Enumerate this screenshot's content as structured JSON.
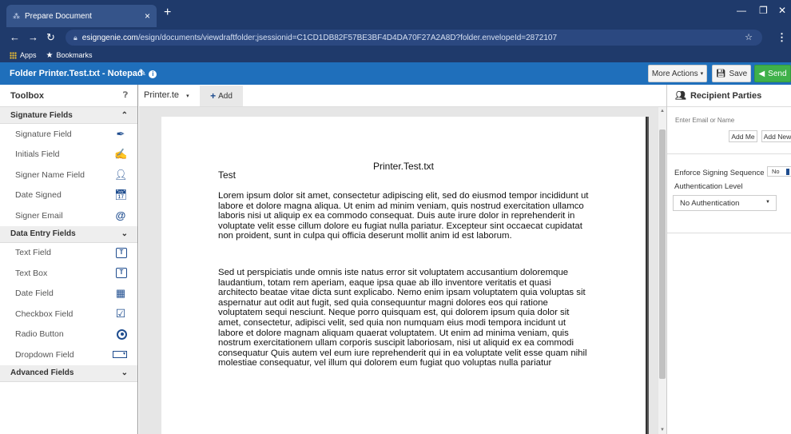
{
  "browser": {
    "tab_title": "Prepare Document",
    "tab_close": "×",
    "new_tab": "+",
    "url_host": "esigngenie.com",
    "url_path": "/esign/documents/viewdraftfolder;jsessionid=C1CD1DB82F57BE3BF4D4DA70F27A2A8D?folder.envelopeId=2872107",
    "bookmarks": [
      "Apps",
      "Bookmarks"
    ]
  },
  "header": {
    "folder_title": "Folder  Printer.Test.txt - Notepad",
    "more_actions_label": "More Actions",
    "save_label": "Save",
    "send_label": "Send"
  },
  "toolbox": {
    "title": "Toolbox",
    "sections": [
      {
        "label": "Signature Fields",
        "items": [
          "Signature Field",
          "Initials Field",
          "Signer Name Field",
          "Date Signed",
          "Signer Email"
        ]
      },
      {
        "label": "Data Entry Fields",
        "items": [
          "Text Field",
          "Text Box",
          "Date Field",
          "Checkbox Field",
          "Radio Button",
          "Dropdown Field"
        ]
      },
      {
        "label": "Advanced Fields",
        "items": []
      }
    ]
  },
  "doc_tabs": {
    "current": "Printer.te",
    "add_label": "Add"
  },
  "document": {
    "title": "Printer.Test.txt",
    "heading": "Test",
    "paragraph1": "Lorem ipsum dolor sit amet, consectetur adipiscing elit, sed do eiusmod tempor incididunt ut labore et dolore magna aliqua. Ut enim ad minim veniam, quis nostrud exercitation ullamco laboris nisi ut aliquip ex ea commodo consequat. Duis aute irure dolor in reprehenderit in voluptate velit esse cillum dolore eu fugiat nulla pariatur. Excepteur sint occaecat cupidatat non proident, sunt in culpa qui officia deserunt mollit anim id est laborum.",
    "paragraph2": "Sed ut perspiciatis unde omnis iste natus error sit voluptatem accusantium doloremque laudantium, totam rem aperiam, eaque ipsa quae ab illo inventore veritatis et quasi architecto beatae vitae dicta sunt explicabo. Nemo enim ipsam voluptatem quia voluptas sit aspernatur aut odit aut fugit, sed quia consequuntur magni dolores eos qui ratione voluptatem sequi nesciunt. Neque porro quisquam est, qui dolorem ipsum quia dolor sit amet, consectetur, adipisci velit, sed quia non numquam eius modi tempora incidunt ut labore et dolore magnam aliquam quaerat voluptatem. Ut enim ad minima veniam, quis nostrum exercitationem ullam corporis suscipit laboriosam, nisi ut aliquid ex ea commodi consequatur Quis autem vel eum iure reprehenderit qui in ea voluptate velit esse quam nihil molestiae consequatur, vel illum qui dolorem eum fugiat quo voluptas nulla pariatur"
  },
  "recipients": {
    "title": "Recipient Parties",
    "email_placeholder": "Enter Email or Name",
    "add_me_label": "Add Me",
    "add_new_label": "Add New",
    "enforce_label": "Enforce Signing Sequence",
    "enforce_value": "No",
    "auth_label": "Authentication Level",
    "auth_value": "No Authentication"
  },
  "colors": {
    "chrome_bg": "#1f3a6b",
    "app_header": "#1f6fbb",
    "send_button": "#3fb14a",
    "icon_blue": "#1f4d8f"
  }
}
